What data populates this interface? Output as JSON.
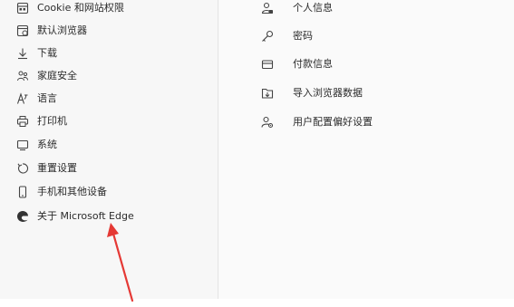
{
  "sidebar": {
    "items": [
      {
        "label": "Cookie 和网站权限",
        "icon": "cookie-site-permissions-icon"
      },
      {
        "label": "默认浏览器",
        "icon": "default-browser-icon"
      },
      {
        "label": "下载",
        "icon": "download-icon"
      },
      {
        "label": "家庭安全",
        "icon": "family-safety-icon"
      },
      {
        "label": "语言",
        "icon": "language-icon"
      },
      {
        "label": "打印机",
        "icon": "printer-icon"
      },
      {
        "label": "系统",
        "icon": "system-icon"
      },
      {
        "label": "重置设置",
        "icon": "reset-icon"
      },
      {
        "label": "手机和其他设备",
        "icon": "phone-icon"
      },
      {
        "label": "关于 Microsoft Edge",
        "icon": "edge-logo-icon"
      }
    ]
  },
  "main": {
    "items": [
      {
        "label": "个人信息",
        "icon": "personal-info-icon"
      },
      {
        "label": "密码",
        "icon": "key-icon"
      },
      {
        "label": "付款信息",
        "icon": "credit-card-icon"
      },
      {
        "label": "导入浏览器数据",
        "icon": "import-data-icon"
      },
      {
        "label": "用户配置偏好设置",
        "icon": "profile-preferences-icon"
      }
    ]
  },
  "colors": {
    "annotation_arrow": "#e53935",
    "text": "#2b2b2b",
    "icon": "#444444"
  }
}
